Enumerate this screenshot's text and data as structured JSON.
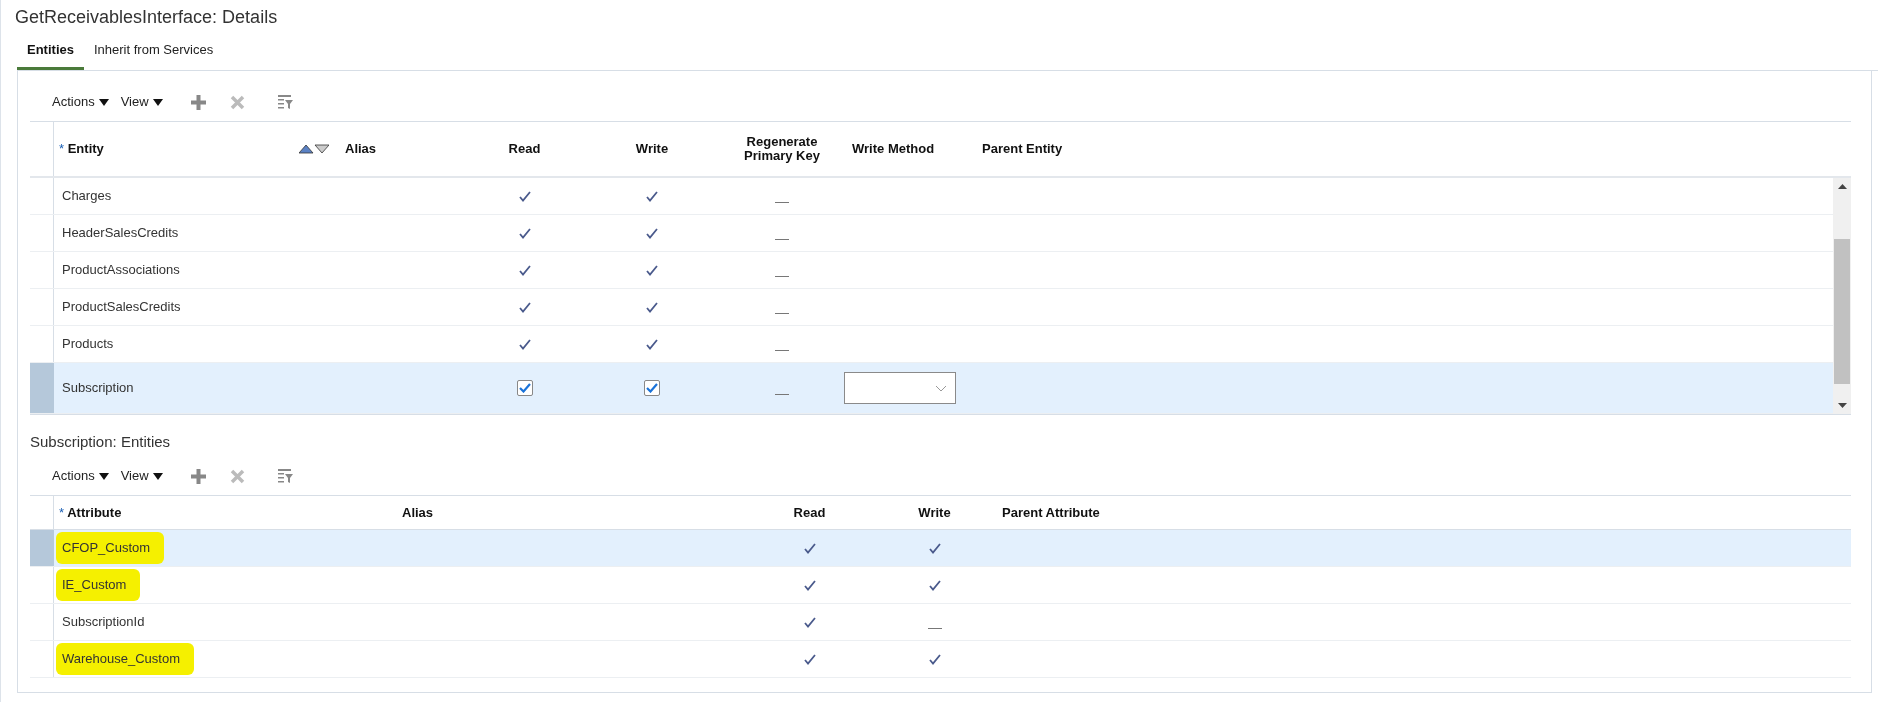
{
  "title": "GetReceivablesInterface: Details",
  "tabs": [
    {
      "label": "Entities",
      "selected": true
    },
    {
      "label": "Inherit from Services",
      "selected": false
    }
  ],
  "entities_table": {
    "toolbar": {
      "actions": "Actions",
      "view": "View"
    },
    "required_mark": "*",
    "columns": [
      "Entity",
      "Alias",
      "Read",
      "Write",
      "Regenerate Primary Key",
      "Write Method",
      "Parent Entity"
    ],
    "rows": [
      {
        "entity": "Charges",
        "read": true,
        "write": true,
        "regenerate": false,
        "selected": false
      },
      {
        "entity": "HeaderSalesCredits",
        "read": true,
        "write": true,
        "regenerate": false,
        "selected": false
      },
      {
        "entity": "ProductAssociations",
        "read": true,
        "write": true,
        "regenerate": false,
        "selected": false
      },
      {
        "entity": "ProductSalesCredits",
        "read": true,
        "write": true,
        "regenerate": false,
        "selected": false
      },
      {
        "entity": "Products",
        "read": true,
        "write": true,
        "regenerate": false,
        "selected": false
      },
      {
        "entity": "Subscription",
        "read": true,
        "write": true,
        "regenerate": false,
        "selected": true
      }
    ]
  },
  "attributes_section": {
    "title": "Subscription: Entities",
    "toolbar": {
      "actions": "Actions",
      "view": "View"
    },
    "required_mark": "*",
    "columns": [
      "Attribute",
      "Alias",
      "Read",
      "Write",
      "Parent Attribute"
    ],
    "rows": [
      {
        "attribute": "CFOP_Custom",
        "read": true,
        "write": true,
        "selected": true,
        "highlighted": true
      },
      {
        "attribute": "IE_Custom",
        "read": true,
        "write": true,
        "selected": false,
        "highlighted": true
      },
      {
        "attribute": "SubscriptionId",
        "read": true,
        "write": false,
        "selected": false,
        "highlighted": false
      },
      {
        "attribute": "Warehouse_Custom",
        "read": true,
        "write": true,
        "selected": false,
        "highlighted": true
      }
    ]
  }
}
